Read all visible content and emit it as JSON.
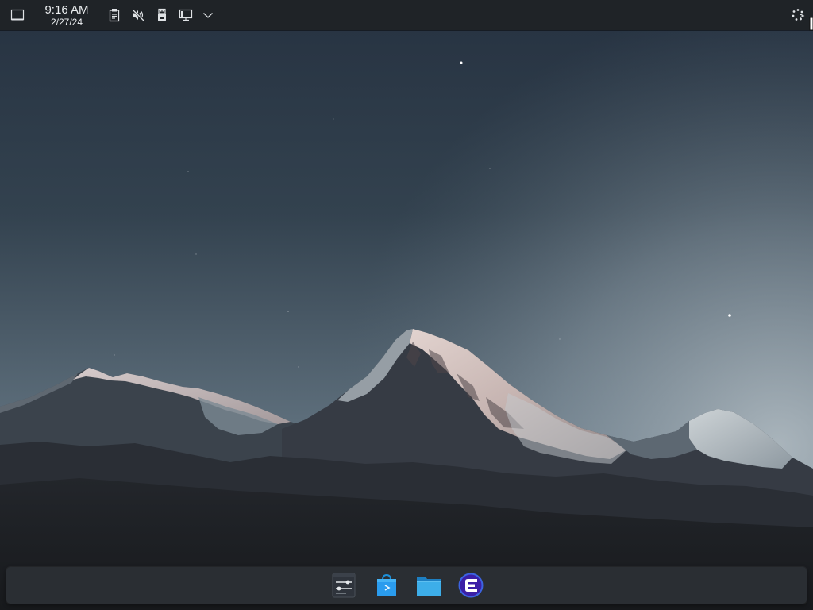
{
  "panel": {
    "show_desktop_icon": "show-desktop-icon",
    "clock": {
      "time": "9:16 AM",
      "date": "2/27/24"
    },
    "tray_icons": [
      "clipboard-icon",
      "volume-muted-icon",
      "removable-device-icon",
      "display-configuration-icon",
      "expand-tray-chevron-icon"
    ],
    "right_icon": "overview-icon"
  },
  "dock": {
    "apps": [
      {
        "icon": "system-settings-icon"
      },
      {
        "icon": "discover-store-icon"
      },
      {
        "icon": "file-manager-folder-icon"
      },
      {
        "icon": "purple-f-app-icon"
      }
    ]
  },
  "wallpaper": {
    "subject": "mountain-range-dusk"
  },
  "colors": {
    "panel_bg": "#1f2327",
    "dock_bg": "#2a2e33",
    "accent": "#3daee9",
    "text": "#eceff1"
  }
}
